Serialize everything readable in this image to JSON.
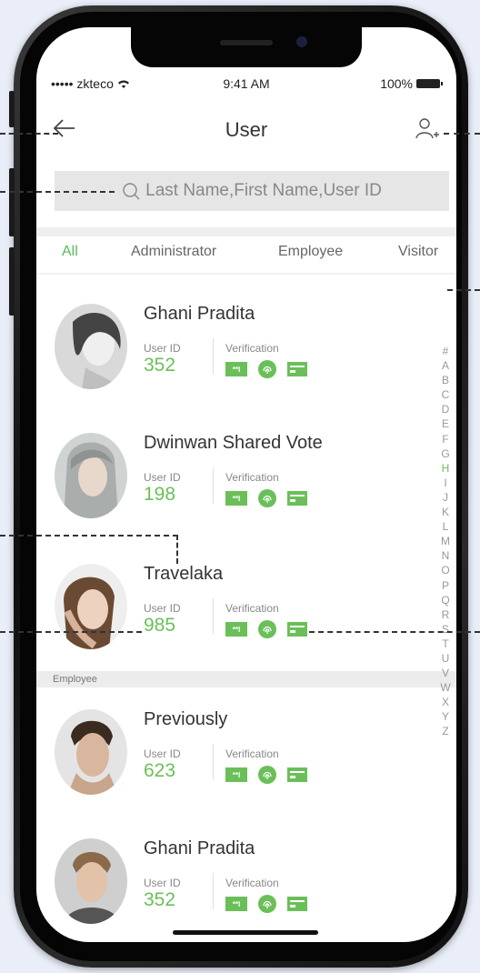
{
  "status_bar": {
    "carrier": "••••• zkteco",
    "time": "9:41 AM",
    "battery": "100%"
  },
  "nav": {
    "title": "User",
    "back_icon": "arrow-left-icon",
    "add_icon": "add-user-icon"
  },
  "search": {
    "placeholder": "Last Name,First Name,User ID",
    "icon": "search-icon"
  },
  "tabs": [
    {
      "label": "All",
      "active": true
    },
    {
      "label": "Administrator",
      "active": false
    },
    {
      "label": "Employee",
      "active": false
    },
    {
      "label": "Visitor",
      "active": false
    }
  ],
  "labels": {
    "user_id": "User ID",
    "verification": "Verification",
    "password_badge": "**I"
  },
  "users": [
    {
      "name": "Ghani Pradita",
      "user_id": "352"
    },
    {
      "name": "Dwinwan Shared Vote",
      "user_id": "198"
    },
    {
      "name": "Travelaka",
      "user_id": "985"
    },
    {
      "name": "Previously",
      "user_id": "623"
    },
    {
      "name": "Ghani Pradita",
      "user_id": "352"
    }
  ],
  "section_header": "Employee",
  "index_letters": [
    "#",
    "A",
    "B",
    "C",
    "D",
    "E",
    "F",
    "G",
    "H",
    "I",
    "J",
    "K",
    "L",
    "M",
    "N",
    "O",
    "P",
    "Q",
    "R",
    "S",
    "T",
    "U",
    "V",
    "W",
    "X",
    "Y",
    "Z"
  ],
  "index_active": "H",
  "colors": {
    "accent": "#6bbf59",
    "text": "#333333",
    "muted": "#888888"
  }
}
